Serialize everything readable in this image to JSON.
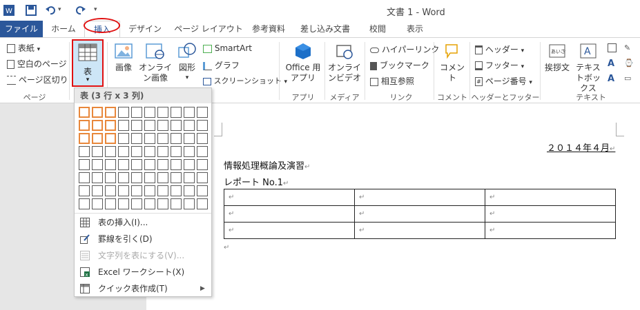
{
  "titlebar": {
    "title": "文書 1 - Word",
    "qat": {
      "word_icon": "word-icon",
      "save": "save-icon",
      "undo": "undo-icon",
      "redo": "redo-icon"
    }
  },
  "tabs": [
    {
      "label": "ファイル"
    },
    {
      "label": "ホーム"
    },
    {
      "label": "挿入"
    },
    {
      "label": "デザイン"
    },
    {
      "label": "ページ レイアウト"
    },
    {
      "label": "参考資料"
    },
    {
      "label": "差し込み文書"
    },
    {
      "label": "校閲"
    },
    {
      "label": "表示"
    }
  ],
  "ribbon": {
    "page_group": {
      "cover": "表紙",
      "blank": "空白のページ",
      "break": "ページ区切り",
      "label": "ページ"
    },
    "table": {
      "label": "表"
    },
    "illustrations": {
      "image": "画像",
      "online_image": "オンライン画像",
      "shapes": "図形",
      "smartart": "SmartArt",
      "graph": "グラフ",
      "screenshot": "スクリーンショット"
    },
    "apps": {
      "office": "Office 用アプリ",
      "label": "アプリ"
    },
    "media": {
      "video": "オンラインビデオ",
      "label": "メディア"
    },
    "links": {
      "hyperlink": "ハイパーリンク",
      "bookmark": "ブックマーク",
      "crossref": "相互参照",
      "label": "リンク"
    },
    "comments": {
      "comment": "コメント",
      "label": "コメント"
    },
    "headerfooter": {
      "header": "ヘッダー",
      "footer": "フッター",
      "pagenum": "ページ番号",
      "label": "ヘッダーとフッター"
    },
    "text": {
      "greeting": "挨拶文",
      "textbox": "テキストボックス",
      "label": "テキスト"
    }
  },
  "dropdown": {
    "header": "表 (3 行 x 3 列)",
    "grid": {
      "cols": 10,
      "rows": 8,
      "sel_cols": 3,
      "sel_rows": 3
    },
    "items": [
      {
        "label": "表の挿入(I)...",
        "disabled": false
      },
      {
        "label": "罫線を引く(D)",
        "disabled": false
      },
      {
        "label": "文字列を表にする(V)...",
        "disabled": true
      },
      {
        "label": "Excel ワークシート(X)",
        "disabled": false
      },
      {
        "label": "クイック表作成(T)",
        "disabled": false
      }
    ]
  },
  "document": {
    "date": "２０１４年４月",
    "line1": "情報処理概論及演習",
    "line2": "レポート  No.1",
    "para_mark": "↵"
  },
  "colors": {
    "file_tab": "#2b579a",
    "highlight": "#e01010",
    "grid_select": "#e8873b"
  }
}
